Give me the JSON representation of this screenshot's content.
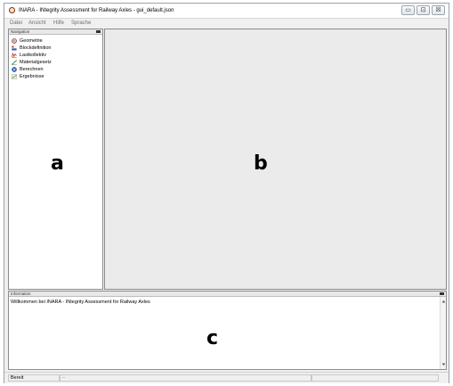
{
  "window": {
    "title": "INARA - INtegrity Assessment for Railway Axles - gui_default.json",
    "controls": {
      "minimize": "▭",
      "maximize": "⊡",
      "close": "☒"
    }
  },
  "menu": [
    "Datei",
    "Ansicht",
    "Hilfe",
    "Sprache"
  ],
  "navigation": {
    "title": "Navigation",
    "items": [
      {
        "label": "Geometrie",
        "icon": "geometry-icon"
      },
      {
        "label": "Blockdefinition",
        "icon": "block-definition-icon"
      },
      {
        "label": "Lastkollektiv",
        "icon": "load-spectrum-icon"
      },
      {
        "label": "Materialgesetz",
        "icon": "material-law-icon"
      },
      {
        "label": "Berechnen",
        "icon": "calculate-icon"
      },
      {
        "label": "Ergebnisse",
        "icon": "results-icon"
      }
    ]
  },
  "information": {
    "title": "Information",
    "message": "Willkommen bei INARA - INtegrity Assessment for Railway Axles"
  },
  "annotations": {
    "a": "a",
    "b": "b",
    "c": "c"
  },
  "status": {
    "text": "Bereit",
    "secondary": "–"
  },
  "colors": {
    "accent": "#8a2a1a",
    "frame": "#9aa3ad"
  }
}
